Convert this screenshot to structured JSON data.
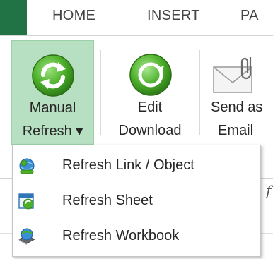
{
  "tabs": [
    {
      "label": "HOME"
    },
    {
      "label": "INSERT"
    },
    {
      "label": "PA"
    }
  ],
  "ribbon": {
    "manual_refresh": {
      "line1": "Manual",
      "line2": "Refresh ▾"
    },
    "edit_download": {
      "line1": "Edit",
      "line2": "Download"
    },
    "send_as_email": {
      "line1": "Send as",
      "line2": "Email"
    }
  },
  "menu": {
    "items": [
      {
        "label": "Refresh Link / Object",
        "icon": "globe-person-icon"
      },
      {
        "label": "Refresh Sheet",
        "icon": "sheet-refresh-icon"
      },
      {
        "label": "Refresh Workbook",
        "icon": "book-globe-icon"
      }
    ]
  },
  "formula_bar": {
    "fx": "f"
  },
  "colors": {
    "file_tab": "#217346",
    "selected_button": "#b7dfc1",
    "refresh_green": "#4caf2a"
  }
}
